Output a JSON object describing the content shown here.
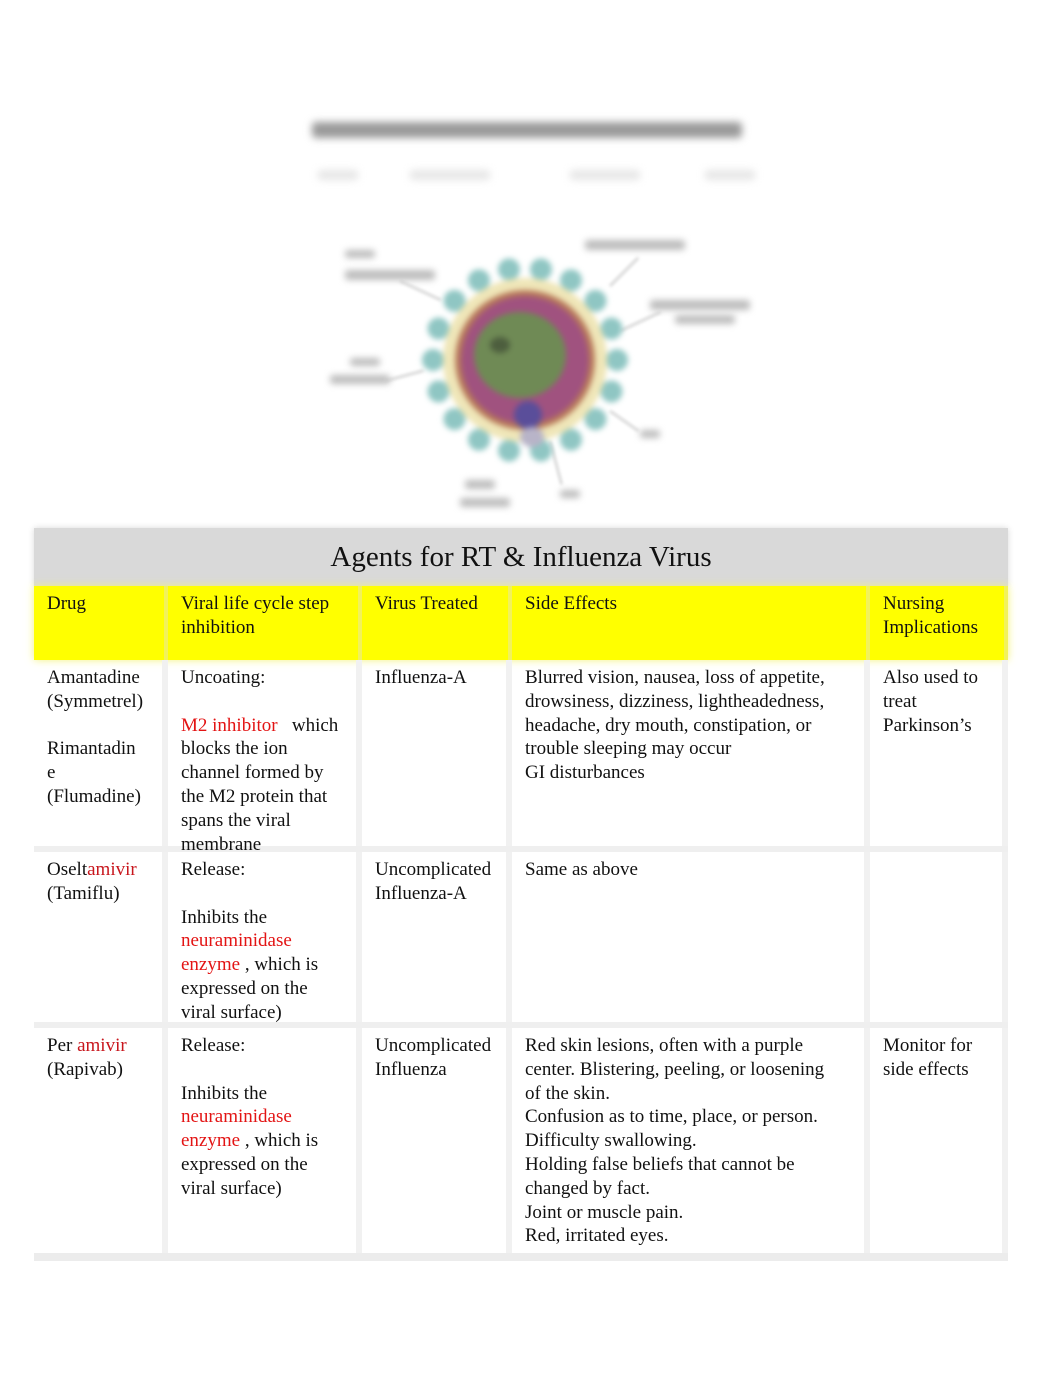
{
  "figure": {
    "title": "STRUCTURE OF THE INFLUENZA VIRION",
    "caption": "blurred diagram of influenza virus structure",
    "colors": {
      "spikes": "#8fc6c3",
      "envelope": "#efe6b8",
      "matrix": "#a0527f",
      "core": "#6f8a55",
      "polymerase": "#5a4e9a"
    }
  },
  "table": {
    "title": "Agents for RT & Influenza Virus",
    "header_color": "#ffff00",
    "title_bg": "#d9d9d9",
    "highlight_color": "#e31414",
    "columns": [
      "Drug",
      "Viral life cycle step inhibition",
      "Virus Treated",
      "Side Effects",
      "Nursing Implications"
    ],
    "rows": [
      {
        "drug": {
          "line1": "Amantadine",
          "line2": "(Symmetrel)",
          "line3": "Rimantadin",
          "line4": "e",
          "line5": "(Flumadine)"
        },
        "step": {
          "label": "Uncoating:",
          "highlight": "M2 inhibitor",
          "rest_first": "which",
          "rest": [
            "blocks the ion",
            "channel formed by",
            "the M2 protein that",
            "spans the viral",
            "membrane"
          ]
        },
        "virus": "Influenza-A",
        "side_effects": [
          "Blurred vision, nausea, loss of appetite,",
          "drowsiness, dizziness, lightheadedness,",
          "headache, dry mouth, constipation, or",
          "trouble sleeping may occur",
          "GI disturbances"
        ],
        "nursing": [
          "Also used to",
          "treat",
          "Parkinson’s"
        ]
      },
      {
        "drug": {
          "prefix": "Oselt",
          "suffix": "amivir",
          "brand": "(Tamiflu)"
        },
        "step": {
          "label": "Release:",
          "line1": "Inhibits the",
          "highlight1": "neuraminidase",
          "highlight2": "enzyme",
          "after": ", which is",
          "rest": [
            "expressed on the",
            "viral surface)"
          ]
        },
        "virus": [
          "Uncomplicated",
          "Influenza-A"
        ],
        "side_effects": [
          "Same as above"
        ],
        "nursing": []
      },
      {
        "drug": {
          "prefix": "Per",
          "suffix": "amivir",
          "brand": "(Rapivab)"
        },
        "step": {
          "label": "Release:",
          "line1": "Inhibits the",
          "highlight1": "neuraminidase",
          "highlight2": "enzyme",
          "after": ", which is",
          "rest": [
            "expressed on the",
            "viral surface)"
          ]
        },
        "virus": [
          "Uncomplicated",
          "Influenza"
        ],
        "side_effects": [
          "Red skin lesions, often with a purple",
          "center. Blistering, peeling, or loosening",
          "of the skin.",
          "Confusion as to time, place, or person.",
          "Difficulty swallowing.",
          "Holding false beliefs that cannot be",
          "changed by fact.",
          "Joint or muscle pain.",
          "Red, irritated eyes."
        ],
        "nursing": [
          "Monitor for",
          "side effects"
        ]
      }
    ]
  }
}
